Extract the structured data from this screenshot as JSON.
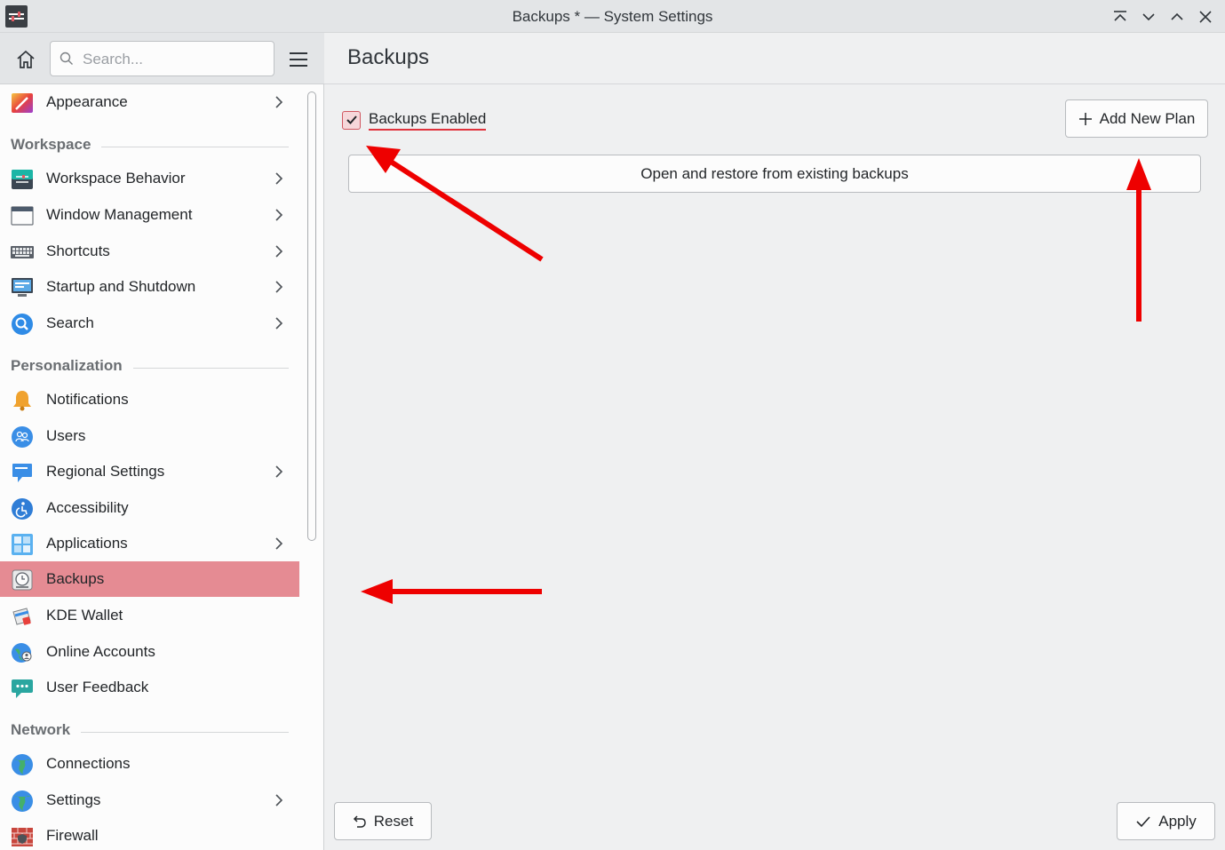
{
  "window": {
    "title": "Backups * — System Settings"
  },
  "sidebar": {
    "search": {
      "placeholder": "Search...",
      "value": ""
    },
    "top_item": {
      "label": "Appearance"
    },
    "sections": {
      "workspace": "Workspace",
      "personalization": "Personalization",
      "network": "Network"
    },
    "workspace_items": [
      {
        "label": "Workspace Behavior"
      },
      {
        "label": "Window Management"
      },
      {
        "label": "Shortcuts"
      },
      {
        "label": "Startup and Shutdown"
      },
      {
        "label": "Search"
      }
    ],
    "personalization_items": [
      {
        "label": "Notifications"
      },
      {
        "label": "Users"
      },
      {
        "label": "Regional Settings"
      },
      {
        "label": "Accessibility"
      },
      {
        "label": "Applications"
      },
      {
        "label": "Backups"
      },
      {
        "label": "KDE Wallet"
      },
      {
        "label": "Online Accounts"
      },
      {
        "label": "User Feedback"
      }
    ],
    "network_items": [
      {
        "label": "Connections"
      },
      {
        "label": "Settings"
      },
      {
        "label": "Firewall"
      }
    ],
    "selected": "Backups"
  },
  "page": {
    "title": "Backups",
    "backups_enabled": {
      "label": "Backups Enabled",
      "checked": true
    },
    "add_plan_label": "Add New Plan",
    "open_restore_label": "Open and restore from existing backups",
    "reset_label": "Reset",
    "apply_label": "Apply"
  },
  "colors": {
    "accent": "#e58b93",
    "annotation_arrow": "#ee0000"
  }
}
